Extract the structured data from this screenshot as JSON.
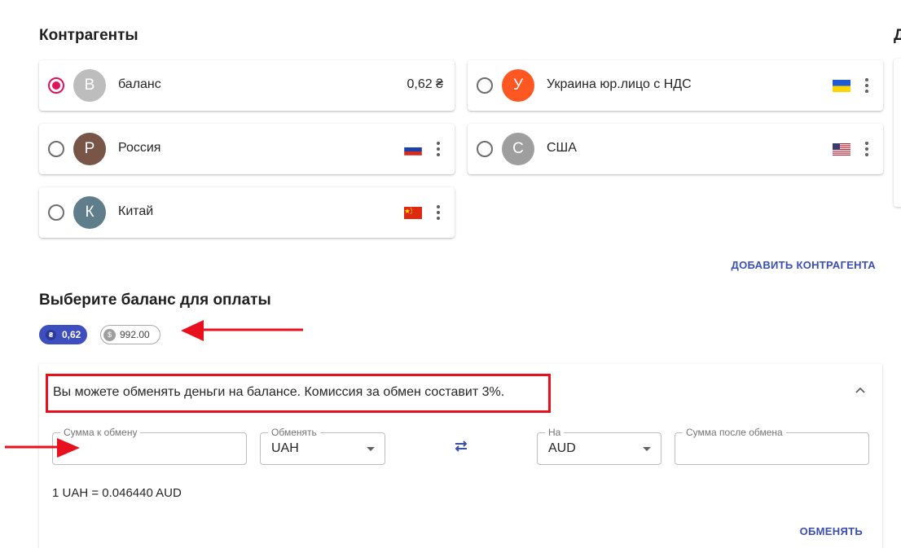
{
  "counterparties": {
    "title": "Контрагенты",
    "items": [
      {
        "initial": "B",
        "name": "баланс",
        "amount": "0,62 ₴",
        "selected": true,
        "avatar_color": "#bdbdbd"
      },
      {
        "initial": "У",
        "name": "Украина юр.лицо с НДС",
        "flag": "ukraine-flag-icon",
        "selected": false,
        "avatar_color": "#ff5722"
      },
      {
        "initial": "Р",
        "name": "Россия",
        "flag": "russia-flag-icon",
        "selected": false,
        "avatar_color": "#795548"
      },
      {
        "initial": "С",
        "name": "США",
        "flag": "usa-flag-icon",
        "selected": false,
        "avatar_color": "#9e9e9e"
      },
      {
        "initial": "К",
        "name": "Китай",
        "flag": "china-flag-icon",
        "selected": false,
        "avatar_color": "#607d8b"
      }
    ],
    "add_button": "ДОБАВИТЬ КОНТРАГЕНТА"
  },
  "side_title": "Д",
  "balance": {
    "title": "Выберите баланс для оплаты",
    "chips": [
      {
        "symbol": "₴",
        "label": "0,62",
        "selected": true
      },
      {
        "symbol": "$",
        "label": "992.00",
        "selected": false
      }
    ]
  },
  "exchange": {
    "notice": "Вы можете обменять деньги на балансе. Комиссия за обмен составит 3%.",
    "amount_label": "Сумма к обмену",
    "amount_value": "",
    "from_label": "Обменять",
    "from_value": "UAH",
    "to_label": "На",
    "to_value": "AUD",
    "result_label": "Сумма после обмена",
    "result_value": "",
    "rate": "1 UAH = 0.046440 AUD",
    "button": "ОБМЕНЯТЬ"
  },
  "colors": {
    "accent": "#3d4ebe",
    "radio_selected": "#e0125a",
    "highlight": "#e8101c"
  }
}
